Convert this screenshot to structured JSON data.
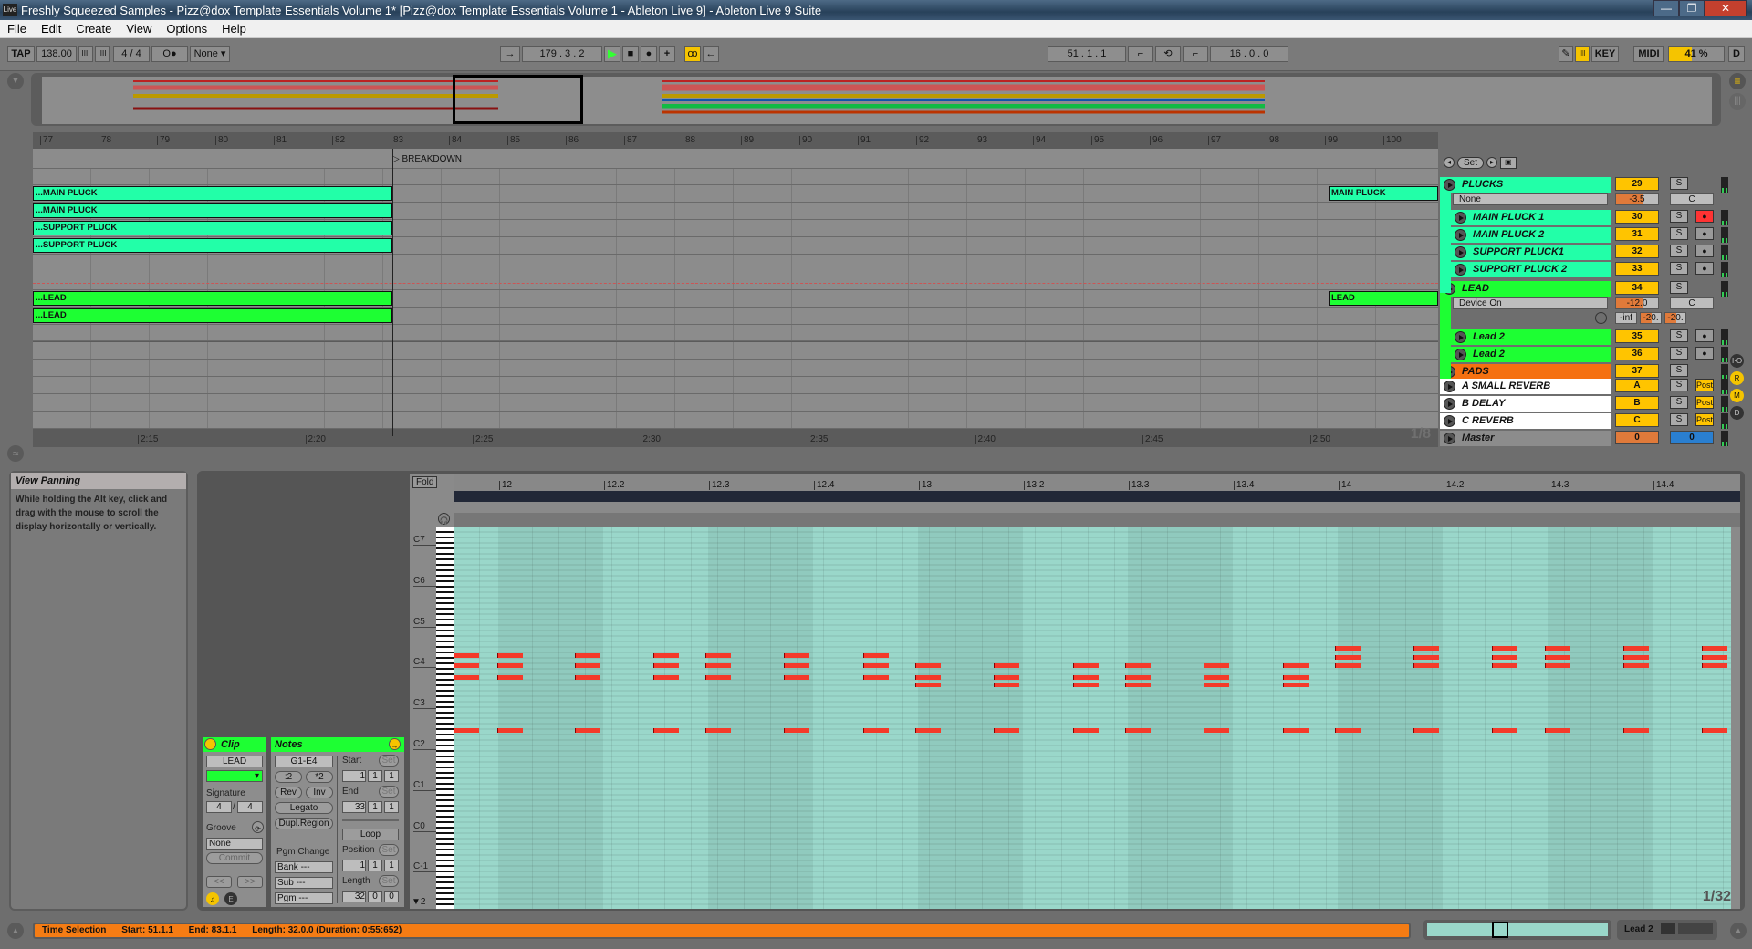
{
  "window": {
    "title": "Freshly Squeezed Samples - Pizz@dox Template Essentials Volume 1*  [Pizz@dox Template Essentials Volume 1 - Ableton Live 9] - Ableton Live 9 Suite",
    "logo": "Live",
    "minimize": "—",
    "restore": "❐",
    "close": "✕"
  },
  "menu": [
    "File",
    "Edit",
    "Create",
    "View",
    "Options",
    "Help"
  ],
  "transport": {
    "tap": "TAP",
    "tempo": "138.00",
    "nudge_down": "IIII",
    "nudge_up": "IIII",
    "signature": "4 / 4",
    "metronome": "O●",
    "quantize": "None ▾",
    "follow": "→",
    "position": "179 .  3 .  2",
    "play": "▶",
    "stop": "■",
    "record": "●",
    "overdub": "+",
    "automation_arm": "ꝏ",
    "back_to_arrangement": "←",
    "loop_start": "51 .  1 .  1",
    "punch_in": "⌐",
    "loop": "⟲",
    "punch_out": "⌐",
    "loop_length": "16 .  0 .  0",
    "draw_mode": "✎",
    "key_map_icon": "III",
    "key": "KEY",
    "midi": "MIDI",
    "cpu_label": "41 %",
    "cpu_percent": 41,
    "disk": "D"
  },
  "arrangement": {
    "bar_numbers": [
      "77",
      "78",
      "79",
      "80",
      "81",
      "82",
      "83",
      "84",
      "85",
      "86",
      "87",
      "88",
      "89",
      "90",
      "91",
      "92",
      "93",
      "94",
      "95",
      "96",
      "97",
      "98",
      "99",
      "100"
    ],
    "locator": "BREAKDOWN",
    "time_labels": [
      "2:15",
      "2:20",
      "2:25",
      "2:30",
      "2:35",
      "2:40",
      "2:45",
      "2:50"
    ],
    "grid": "1/8",
    "locator_controls": {
      "prev": "◂",
      "set": "Set",
      "next": "▸",
      "lock": "🔒"
    },
    "clips": [
      {
        "lane": 1,
        "label": "...MAIN PLUCK",
        "color": "mint"
      },
      {
        "lane": 2,
        "label": "...MAIN PLUCK",
        "color": "mint"
      },
      {
        "lane": 3,
        "label": "...SUPPORT PLUCK",
        "color": "mint"
      },
      {
        "lane": 4,
        "label": "...SUPPORT PLUCK",
        "color": "mint"
      },
      {
        "lane": 6,
        "label": "...LEAD",
        "color": "green"
      },
      {
        "lane": 7,
        "label": "...LEAD",
        "color": "green"
      },
      {
        "lane": 1,
        "label": "MAIN PLUCK",
        "color": "mint"
      },
      {
        "lane": 6,
        "label": "LEAD",
        "color": "green"
      }
    ]
  },
  "tracks": [
    {
      "name": "PLUCKS",
      "num": "29",
      "solo": "S",
      "group": true,
      "color": "#22ffa8"
    },
    {
      "name": "MAIN PLUCK 1",
      "num": "30",
      "solo": "S",
      "armed": true,
      "color": "#22ffa8"
    },
    {
      "name": "MAIN PLUCK 2",
      "num": "31",
      "solo": "S",
      "color": "#22ffa8"
    },
    {
      "name": "SUPPORT PLUCK1",
      "num": "32",
      "solo": "S",
      "color": "#22ffa8"
    },
    {
      "name": "SUPPORT PLUCK 2",
      "num": "33",
      "solo": "S",
      "color": "#22ffa8"
    },
    {
      "name": "LEAD",
      "num": "34",
      "solo": "S",
      "group": true,
      "color": "#1dff33"
    },
    {
      "name": "Lead 2",
      "num": "35",
      "solo": "S",
      "color": "#1dff33"
    },
    {
      "name": "Lead 2",
      "num": "36",
      "solo": "S",
      "color": "#1dff33"
    },
    {
      "name": "PADS",
      "num": "37",
      "solo": "S",
      "group": true,
      "color": "#f57010"
    },
    {
      "name": "A SMALL REVERB",
      "num": "A",
      "solo": "S",
      "post": "Post",
      "color": "#ffffff"
    },
    {
      "name": "B DELAY",
      "num": "B",
      "solo": "S",
      "post": "Post",
      "color": "#ffffff"
    },
    {
      "name": "C REVERB",
      "num": "C",
      "solo": "S",
      "post": "Post",
      "color": "#ffffff"
    },
    {
      "name": "Master",
      "vol": "0",
      "pan": "0",
      "color": "#8c8c8c"
    }
  ],
  "plucks_expanded": {
    "chooser": "None",
    "volume": "-3.5",
    "pan": "C"
  },
  "lead_expanded": {
    "chooser": "Device On",
    "volume": "-12.0",
    "pan": "C",
    "sends": [
      "-inf",
      "-20.",
      "-20."
    ]
  },
  "side_buttons": [
    "I·O",
    "R",
    "M",
    "D"
  ],
  "info_view": {
    "title": "View Panning",
    "text": "While holding the Alt key, click and drag with the mouse to scroll the display horizontally or vertically."
  },
  "clip_box": {
    "header": "Clip",
    "name": "LEAD",
    "signature_label": "Signature",
    "sig_num": "4",
    "sig_den": "4",
    "groove_label": "Groove",
    "groove_value": "None",
    "commit": "Commit",
    "prev": "<<",
    "next": ">>"
  },
  "notes_box": {
    "header": "Notes",
    "range": "G1-E4",
    "half": ":2",
    "double": "*2",
    "rev": "Rev",
    "inv": "Inv",
    "legato": "Legato",
    "dupl": "Dupl.Region",
    "pgm_change": "Pgm Change",
    "bank": "Bank ---",
    "sub": "Sub ---",
    "pgm": "Pgm ---",
    "start_label": "Start",
    "start": [
      "1",
      "1",
      "1"
    ],
    "end_label": "End",
    "end": [
      "33",
      "1",
      "1"
    ],
    "set": "Set",
    "loop": "Loop",
    "position_label": "Position",
    "position": [
      "1",
      "1",
      "1"
    ],
    "length_label": "Length",
    "length": [
      "32",
      "0",
      "0"
    ]
  },
  "piano_roll": {
    "fold": "Fold",
    "ruler": [
      "12",
      "12.2",
      "12.3",
      "12.4",
      "13",
      "13.2",
      "13.3",
      "13.4",
      "14",
      "14.2",
      "14.3",
      "14.4"
    ],
    "octaves": [
      "C7",
      "C6",
      "C5",
      "C4",
      "C3",
      "C2",
      "C1",
      "C0",
      "C-1"
    ],
    "grid": "1/32",
    "scroll_label": "2"
  },
  "status_bar": {
    "label": "Time Selection",
    "start": "Start: 51.1.1",
    "end": "End: 83.1.1",
    "length": "Length: 32.0.0  (Duration: 0:55:652)"
  },
  "device_chain": {
    "track": "Lead 2"
  }
}
